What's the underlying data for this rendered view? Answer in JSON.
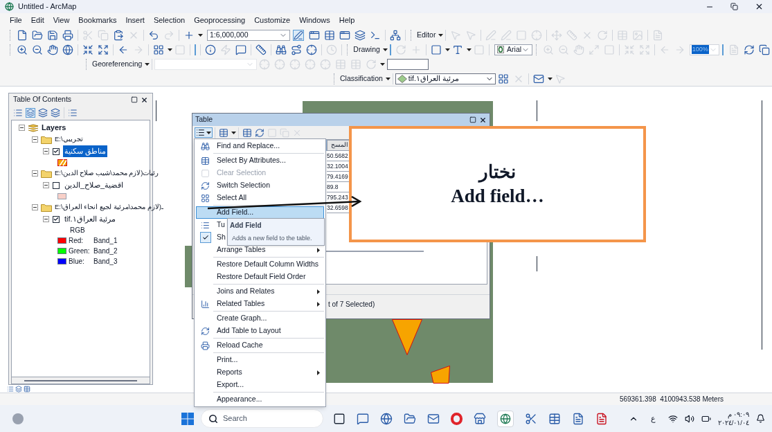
{
  "window": {
    "title": "Untitled - ArcMap"
  },
  "menu_bar": [
    "File",
    "Edit",
    "View",
    "Bookmarks",
    "Insert",
    "Selection",
    "Geoprocessing",
    "Customize",
    "Windows",
    "Help"
  ],
  "toolbars": {
    "scale": "1:6,000,000",
    "editor": "Editor",
    "drawing": "Drawing",
    "font": "Arial",
    "zoom": "100%",
    "georeferencing": "Georeferencing",
    "classification": "Classification",
    "layer": "مرئية العراق١.tif"
  },
  "table_of_contents": {
    "title": "Table Of Contents",
    "root": {
      "kind": "root",
      "label": "Layers",
      "expanded": true,
      "children": [
        {
          "kind": "folder",
          "label": "E:\\تجريبي",
          "expanded": true,
          "children": [
            {
              "kind": "layer",
              "label": "مناطق سكنية",
              "checked": true,
              "selected": true,
              "expanded": true,
              "legend": [
                {
                  "kind": "hatch"
                }
              ]
            }
          ]
        },
        {
          "kind": "folder",
          "label": "E:\\رئيات(لازم محمد\\شيب صلاح الدين",
          "expanded": true,
          "children": [
            {
              "kind": "layer",
              "label": "اقضية_صلاح_الدين",
              "checked": false,
              "selected": false,
              "expanded": true,
              "legend": [
                {
                  "kind": "fill",
                  "color": "#f8d0c8"
                }
              ]
            }
          ]
        },
        {
          "kind": "folder",
          "label": "E:\\ـ(لازم محمد\\مرئية لجيع انحاء العراق",
          "expanded": true,
          "children": [
            {
              "kind": "layer",
              "label": "مرئية العراق١.tif",
              "checked": true,
              "selected": false,
              "expanded": true,
              "legend": [
                {
                  "kind": "text",
                  "label": "RGB"
                },
                {
                  "kind": "band",
                  "label": "Red:",
                  "value": "Band_1",
                  "color": "#ff0000"
                },
                {
                  "kind": "band",
                  "label": "Green:",
                  "value": "Band_2",
                  "color": "#00ff00"
                },
                {
                  "kind": "band",
                  "label": "Blue:",
                  "value": "Band_3",
                  "color": "#0000ff"
                }
              ]
            }
          ]
        }
      ]
    }
  },
  "table_window": {
    "title": "Table",
    "column_header": "المسح",
    "cells": [
      "50.5682",
      "32.1004",
      "79.4169",
      "89.8",
      "795.243",
      "32.6598"
    ],
    "status": "t of 7 Selected)"
  },
  "context_menu": {
    "groups": [
      [
        {
          "kind": "command",
          "label": "Find and Replace...",
          "disabled": false,
          "selected": false
        }
      ],
      [
        {
          "kind": "command",
          "label": "Select By Attributes...",
          "disabled": false,
          "selected": false
        },
        {
          "kind": "command",
          "label": "Clear Selection",
          "disabled": true,
          "selected": false
        },
        {
          "kind": "command",
          "label": "Switch Selection",
          "disabled": false,
          "selected": false
        },
        {
          "kind": "command",
          "label": "Select All",
          "disabled": false,
          "selected": false
        }
      ],
      [
        {
          "kind": "command",
          "label": "Add Field...",
          "disabled": false,
          "selected": true
        },
        {
          "kind": "command",
          "label": "Tu",
          "disabled": false,
          "selected": false
        },
        {
          "kind": "toggle",
          "label": "Sh",
          "checked": true,
          "disabled": false,
          "selected": false
        },
        {
          "kind": "submenu",
          "label": "Arrange Tables",
          "disabled": false,
          "selected": false
        }
      ],
      [
        {
          "kind": "command",
          "label": "Restore Default Column Widths",
          "disabled": false,
          "selected": false
        },
        {
          "kind": "command",
          "label": "Restore Default Field Order",
          "disabled": false,
          "selected": false
        }
      ],
      [
        {
          "kind": "submenu",
          "label": "Joins and Relates",
          "disabled": false,
          "selected": false
        },
        {
          "kind": "submenu",
          "label": "Related Tables",
          "disabled": false,
          "selected": false
        }
      ],
      [
        {
          "kind": "command",
          "label": "Create Graph...",
          "disabled": false,
          "selected": false
        },
        {
          "kind": "command",
          "label": "Add Table to Layout",
          "disabled": false,
          "selected": false
        }
      ],
      [
        {
          "kind": "command",
          "label": "Reload Cache",
          "disabled": false,
          "selected": false
        }
      ],
      [
        {
          "kind": "command",
          "label": "Print...",
          "disabled": false,
          "selected": false
        },
        {
          "kind": "submenu",
          "label": "Reports",
          "disabled": false,
          "selected": false
        },
        {
          "kind": "command",
          "label": "Export...",
          "disabled": false,
          "selected": false
        }
      ],
      [
        {
          "kind": "command",
          "label": "Appearance...",
          "disabled": false,
          "selected": false
        }
      ]
    ]
  },
  "tooltip": {
    "title": "Add Field",
    "text": "Adds a new field to the table."
  },
  "callout": {
    "line_1": "نختار",
    "line_2": "Add field…"
  },
  "status_bar": {
    "coordinates": "569361.398  4100943.538 Meters"
  },
  "taskbar": {
    "search_placeholder": "Search",
    "language": "ع",
    "time": "٠٩:٠٩ م",
    "date": "٢٠٢٤/٠١/٠٤"
  }
}
